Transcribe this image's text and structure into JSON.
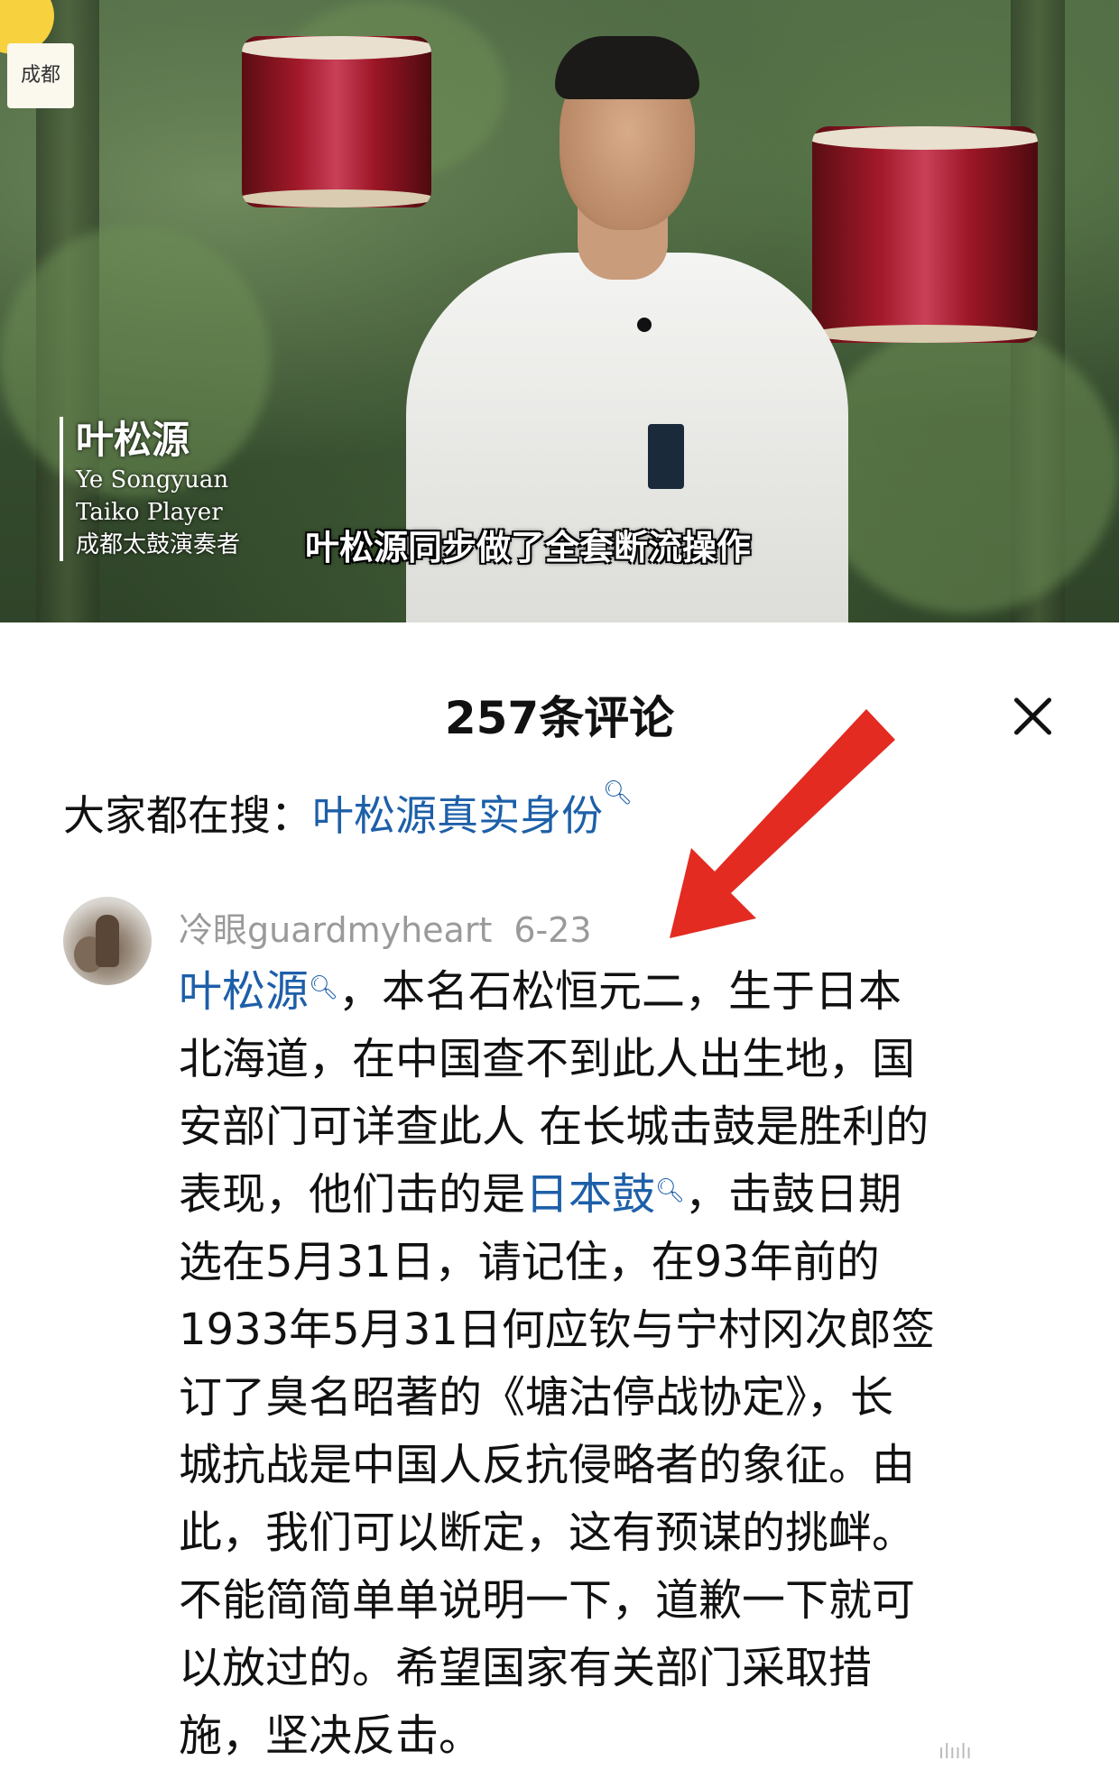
{
  "video": {
    "channel_logo": "成都",
    "speaker_name_cn": "叶松源",
    "speaker_name_en": "Ye Songyuan",
    "speaker_role_en": "Taiko Player",
    "speaker_role_cn": "成都太鼓演奏者",
    "subtitle": "叶松源同步做了全套断流操作"
  },
  "sheet": {
    "title": "257条评论",
    "close_icon": "close-icon"
  },
  "hot_search": {
    "prefix": "大家都在搜：",
    "query": "叶松源真实身份",
    "icon": "search-icon"
  },
  "comment": {
    "username": "冷眼guardmyheart",
    "date": "6-23",
    "lines": [
      {
        "pre": "",
        "link": "叶松源",
        "post": "，本名石松恒元二，生于日本"
      },
      {
        "pre": "北海道，在中国查不到此人出生地，国",
        "link": "",
        "post": ""
      },
      {
        "pre": "安部门可详查此人 在长城击鼓是胜利的",
        "link": "",
        "post": ""
      },
      {
        "pre": "表现，他们击的是",
        "link": "日本鼓",
        "post": "，击鼓日期"
      },
      {
        "pre": "选在5月31日，请记住，在93年前的",
        "link": "",
        "post": ""
      },
      {
        "pre": "1933年5月31日何应钦与宁村冈次郎签",
        "link": "",
        "post": ""
      },
      {
        "pre": "订了臭名昭著的《塘沽停战协定》，长",
        "link": "",
        "post": ""
      },
      {
        "pre": "城抗战是中国人反抗侵略者的象征。由",
        "link": "",
        "post": ""
      },
      {
        "pre": "此，我们可以断定，这有预谋的挑衅。",
        "link": "",
        "post": ""
      },
      {
        "pre": "不能简简单单说明一下，道歉一下就可",
        "link": "",
        "post": ""
      },
      {
        "pre": "以放过的。希望国家有关部门采取措",
        "link": "",
        "post": ""
      },
      {
        "pre": "施，坚决反击。",
        "link": "",
        "post": ""
      }
    ]
  },
  "colors": {
    "link": "#1d5fa8",
    "arrow": "#e32b22",
    "meta": "#9a9a9a"
  }
}
